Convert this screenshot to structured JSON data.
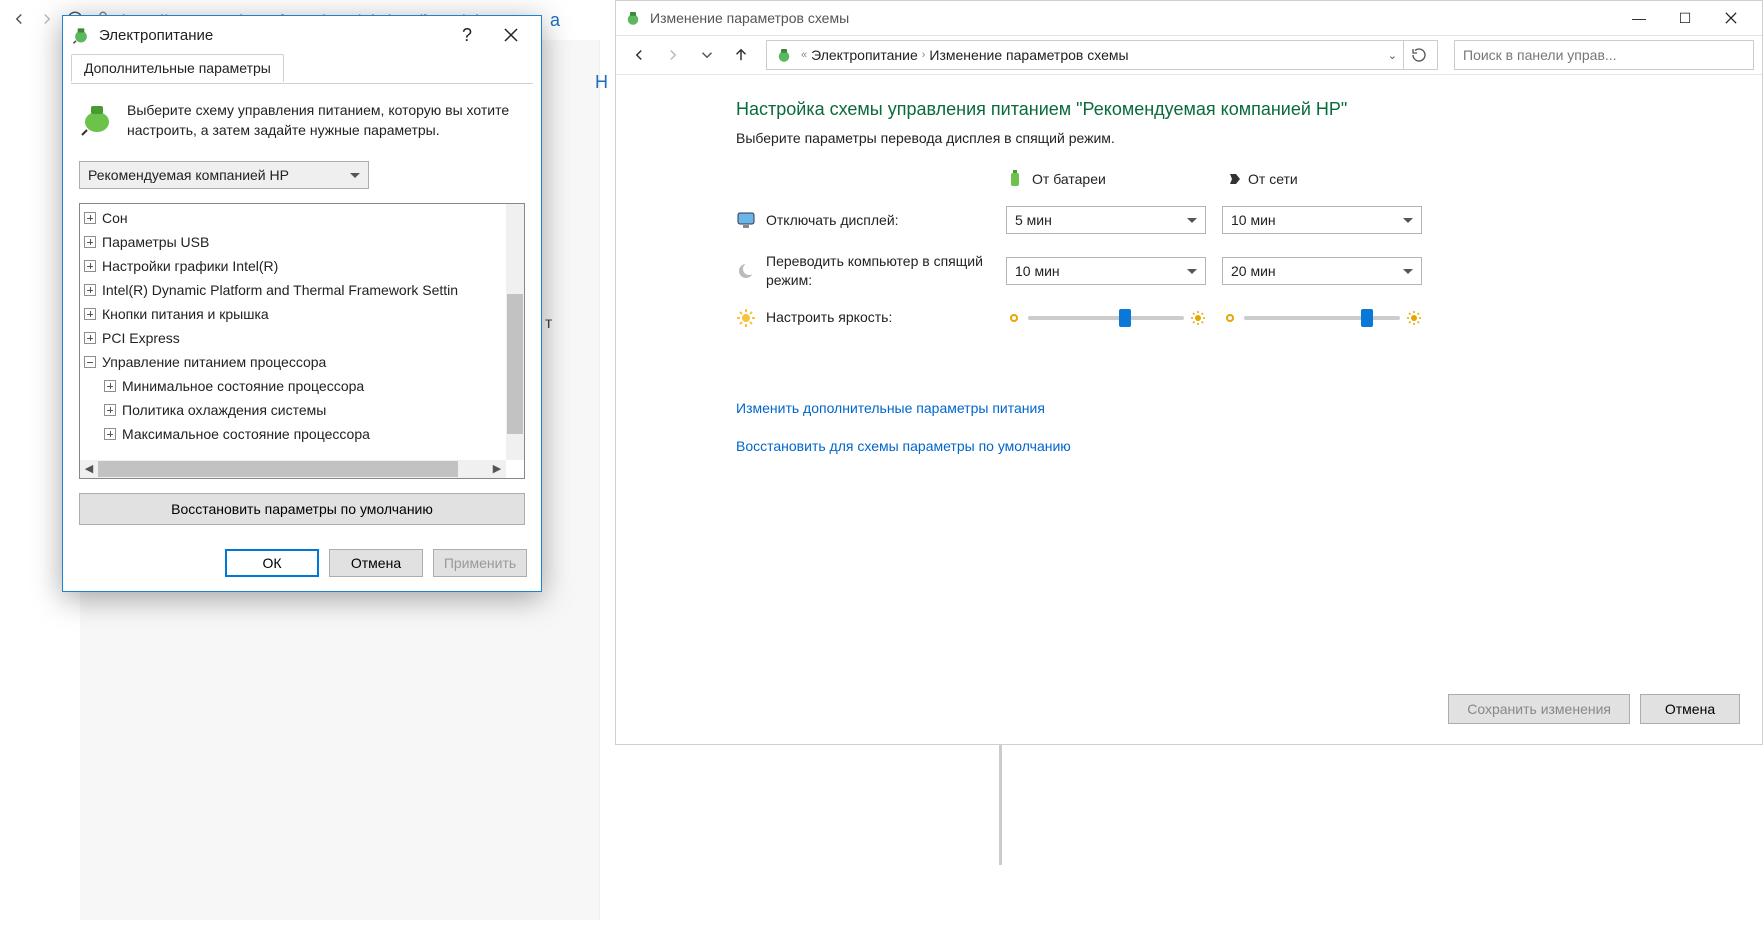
{
  "browser": {
    "url": "https://answers.microsoft.com/ru-ru/windows/forum/wi"
  },
  "bg": {
    "letter1": "а",
    "letter2": "Н",
    "letter3": "т"
  },
  "dialog1": {
    "title": "Электропитание",
    "tab": "Дополнительные параметры",
    "instruction": "Выберите схему управления питанием, которую вы хотите настроить, а затем задайте нужные параметры.",
    "selected_plan": "Рекомендуемая компанией HP",
    "tree": [
      {
        "label": "Сон",
        "expanded": false,
        "level": 0
      },
      {
        "label": "Параметры USB",
        "expanded": false,
        "level": 0
      },
      {
        "label": "Настройки графики Intel(R)",
        "expanded": false,
        "level": 0
      },
      {
        "label": "Intel(R) Dynamic Platform and Thermal Framework Settin",
        "expanded": false,
        "level": 0
      },
      {
        "label": "Кнопки питания и крышка",
        "expanded": false,
        "level": 0
      },
      {
        "label": "PCI Express",
        "expanded": false,
        "level": 0
      },
      {
        "label": "Управление питанием процессора",
        "expanded": true,
        "level": 0
      },
      {
        "label": "Минимальное состояние процессора",
        "expanded": false,
        "level": 1
      },
      {
        "label": "Политика охлаждения системы",
        "expanded": false,
        "level": 1
      },
      {
        "label": "Максимальное состояние процессора",
        "expanded": false,
        "level": 1
      }
    ],
    "restore": "Восстановить параметры по умолчанию",
    "ok": "ОК",
    "cancel": "Отмена",
    "apply": "Применить"
  },
  "win2": {
    "title": "Изменение параметров схемы",
    "crumb1": "Электропитание",
    "crumb2": "Изменение параметров схемы",
    "search_placeholder": "Поиск в панели управ...",
    "heading": "Настройка схемы управления питанием \"Рекомендуемая компанией HP\"",
    "sub": "Выберите параметры перевода дисплея в спящий режим.",
    "hdr_battery": "От батареи",
    "hdr_ac": "От сети",
    "row_display": "Отключать дисплей:",
    "row_sleep": "Переводить компьютер в спящий режим:",
    "row_brightness": "Настроить яркость:",
    "display_battery": "5 мин",
    "display_ac": "10 мин",
    "sleep_battery": "10 мин",
    "sleep_ac": "20 мин",
    "brightness_battery_pct": 70,
    "brightness_ac_pct": 90,
    "link_advanced": "Изменить дополнительные параметры питания",
    "link_restore": "Восстановить для схемы параметры по умолчанию",
    "save": "Сохранить изменения",
    "cancel": "Отмена"
  }
}
